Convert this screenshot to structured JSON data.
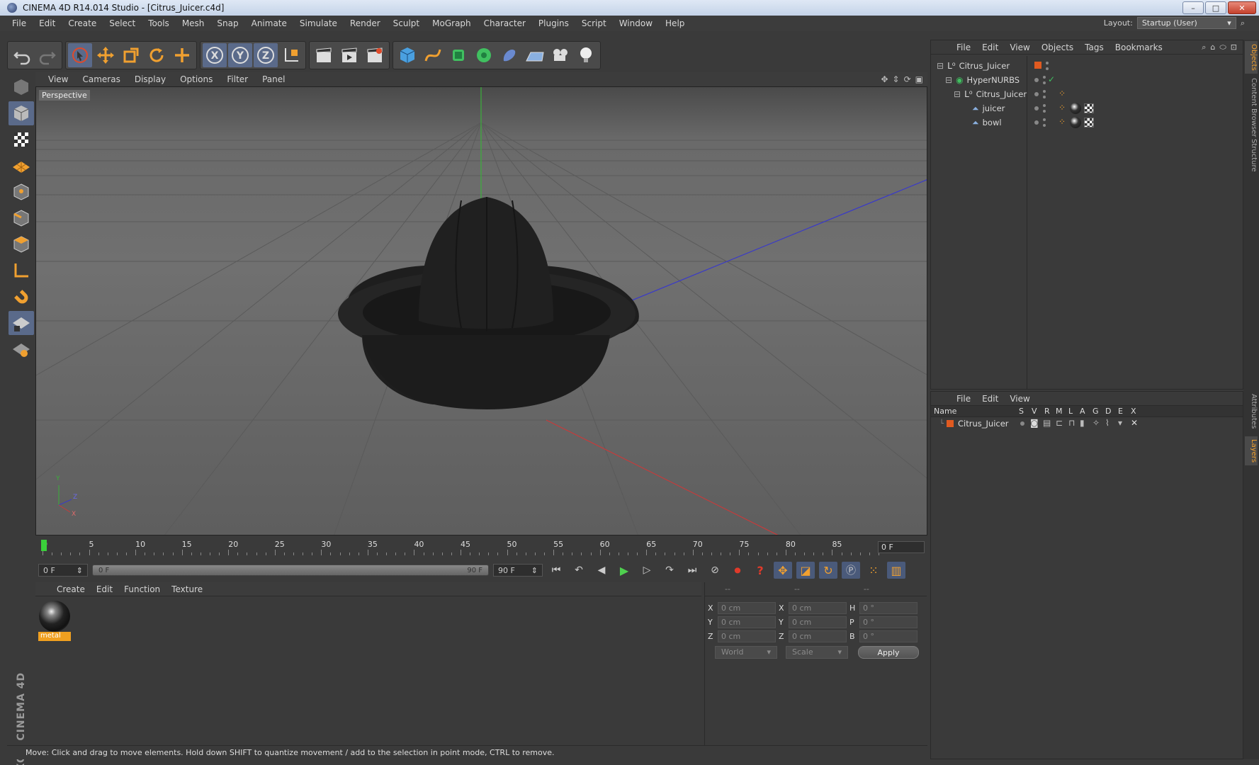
{
  "window": {
    "title": "CINEMA 4D R14.014 Studio - [Citrus_Juicer.c4d]",
    "controls": {
      "minimize": "–",
      "maximize": "□",
      "close": "✕"
    }
  },
  "menubar": {
    "items": [
      "File",
      "Edit",
      "Create",
      "Select",
      "Tools",
      "Mesh",
      "Snap",
      "Animate",
      "Simulate",
      "Render",
      "Sculpt",
      "MoGraph",
      "Character",
      "Plugins",
      "Script",
      "Window",
      "Help"
    ],
    "layout_label": "Layout:",
    "layout_value": "Startup (User)"
  },
  "viewport": {
    "menu": [
      "View",
      "Cameras",
      "Display",
      "Options",
      "Filter",
      "Panel"
    ],
    "label": "Perspective",
    "axis_labels": {
      "y": "Y",
      "z": "Z",
      "x": "X"
    }
  },
  "timeline": {
    "ticks": [
      "0",
      "5",
      "10",
      "15",
      "20",
      "25",
      "30",
      "35",
      "40",
      "45",
      "50",
      "55",
      "60",
      "65",
      "70",
      "75",
      "80",
      "85",
      "90"
    ],
    "current_frame": "0 F"
  },
  "transport": {
    "start_field": "0 F",
    "range_start": "0 F",
    "range_end": "90 F",
    "end_field": "90 F"
  },
  "material_manager": {
    "menu": [
      "Create",
      "Edit",
      "Function",
      "Texture"
    ],
    "materials": [
      {
        "name": "metal"
      }
    ]
  },
  "coordinates": {
    "headers": [
      "--",
      "--",
      "--"
    ],
    "rows": [
      {
        "pos_axis": "X",
        "pos": "0 cm",
        "size_axis": "X",
        "size": "0 cm",
        "rot_axis": "H",
        "rot": "0 °"
      },
      {
        "pos_axis": "Y",
        "pos": "0 cm",
        "size_axis": "Y",
        "size": "0 cm",
        "rot_axis": "P",
        "rot": "0 °"
      },
      {
        "pos_axis": "Z",
        "pos": "0 cm",
        "size_axis": "Z",
        "size": "0 cm",
        "rot_axis": "B",
        "rot": "0 °"
      }
    ],
    "mode_world": "World",
    "mode_scale": "Scale",
    "apply_label": "Apply"
  },
  "status": {
    "text": "Move: Click and drag to move elements. Hold down SHIFT to quantize movement / add to the selection in point mode, CTRL to remove."
  },
  "object_manager": {
    "menu": [
      "File",
      "Edit",
      "View",
      "Objects",
      "Tags",
      "Bookmarks"
    ],
    "objects": [
      {
        "name": "Citrus_Juicer"
      },
      {
        "name": "HyperNURBS"
      },
      {
        "name": "Citrus_Juicer"
      },
      {
        "name": "juicer"
      },
      {
        "name": "bowl"
      }
    ]
  },
  "layer_manager": {
    "menu": [
      "File",
      "Edit",
      "View"
    ],
    "columns": [
      "Name",
      "S",
      "V",
      "R",
      "M",
      "L",
      "A",
      "G",
      "D",
      "E",
      "X"
    ],
    "layers": [
      {
        "name": "Citrus_Juicer",
        "color": "#e05a20"
      }
    ]
  },
  "side_tabs": [
    "Objects",
    "Content Browser",
    "Structure",
    "Attributes",
    "Layers"
  ],
  "colors": {
    "accent_orange": "#f0a030",
    "axis_x": "#c83a3a",
    "axis_y": "#3ab03a",
    "axis_z": "#3a3ac8",
    "active_tool": "#5a6a8a"
  }
}
